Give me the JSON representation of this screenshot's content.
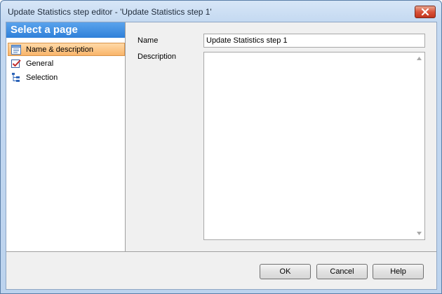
{
  "window": {
    "title": "Update Statistics step editor - 'Update Statistics step 1'"
  },
  "sidebar": {
    "header": "Select a page",
    "items": [
      {
        "label": "Name & description",
        "icon": "document-list-icon",
        "selected": true
      },
      {
        "label": "General",
        "icon": "checkbox-checked-icon",
        "selected": false
      },
      {
        "label": "Selection",
        "icon": "tree-icon",
        "selected": false
      }
    ]
  },
  "form": {
    "name_label": "Name",
    "name_value": "Update Statistics step 1",
    "description_label": "Description",
    "description_value": ""
  },
  "buttons": {
    "ok": "OK",
    "cancel": "Cancel",
    "help": "Help"
  },
  "colors": {
    "sidebar_header": "#2f80d9",
    "selected_item": "#f9b56a",
    "close_button": "#d9533a"
  }
}
